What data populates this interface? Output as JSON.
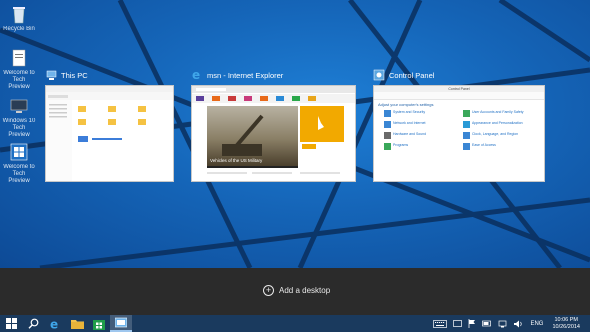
{
  "desktop": {
    "icons": [
      {
        "label": "Recycle Bin",
        "icon": "recycle-bin-icon"
      },
      {
        "label": "Welcome to Tech Preview",
        "icon": "document-icon"
      },
      {
        "label": "Windows 10 Tech Preview",
        "icon": "computer-icon"
      },
      {
        "label": "Welcome to Tech Preview",
        "icon": "windows-logo-icon"
      }
    ]
  },
  "task_view": {
    "windows": [
      {
        "title": "This PC",
        "icon": "this-pc-icon"
      },
      {
        "title": "msn - Internet Explorer",
        "icon": "internet-explorer-icon"
      },
      {
        "title": "Control Panel",
        "icon": "control-panel-icon"
      }
    ],
    "ie_thumb": {
      "caption": "Vehicles of the US Military"
    },
    "cp_thumb": {
      "heading": "Adjust your computer's settings",
      "window_title": "Control Panel",
      "items": [
        "System and Security",
        "User Accounts and Family Safety",
        "Network and Internet",
        "Appearance and Personalization",
        "Hardware and Sound",
        "Clock, Language, and Region",
        "Programs",
        "Ease of Access"
      ]
    },
    "add_desktop_label": "Add a desktop"
  },
  "taskbar": {
    "apps": [
      "start-button",
      "search",
      "internet-explorer",
      "file-explorer",
      "store",
      "task-view"
    ],
    "tray": {
      "language": "ENG",
      "time": "10:06 PM",
      "date": "10/26/2014"
    }
  },
  "colors": {
    "wallpaper": "#1565b8",
    "panel": "#2b2b2b",
    "taskbar": "#1a3a5e",
    "accent": "#0078d7"
  }
}
